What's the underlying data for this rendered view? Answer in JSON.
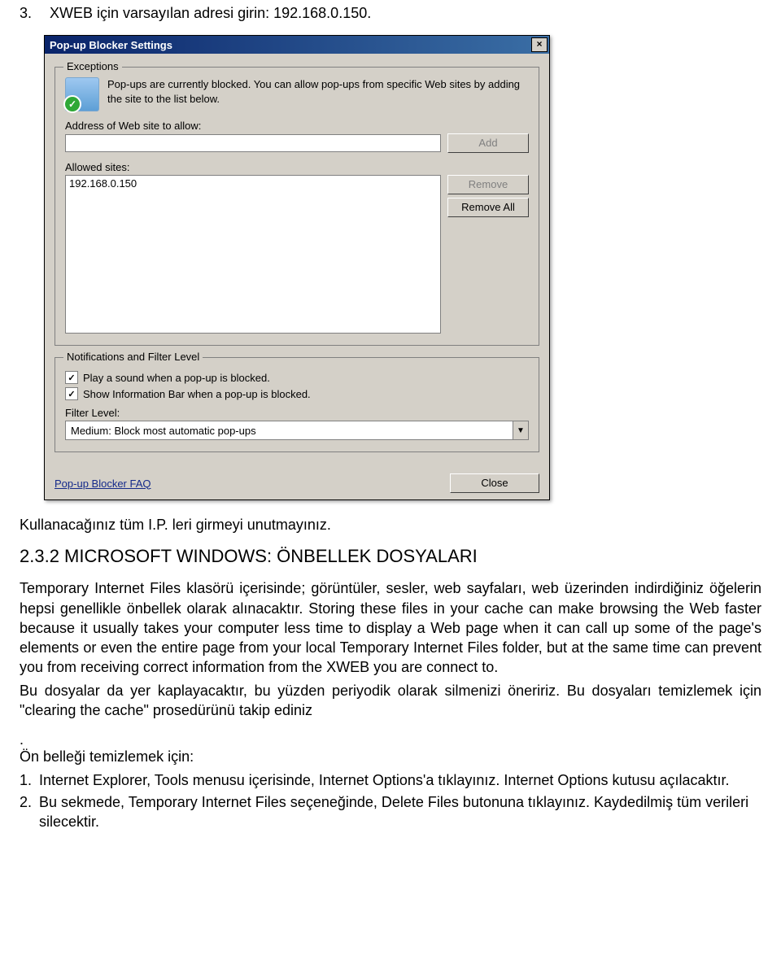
{
  "doc": {
    "step3_num": "3.",
    "step3_text": "XWEB için varsayılan adresi girin: 192.168.0.150.",
    "after_dialog": "Kullanacağınız tüm I.P. leri girmeyi unutmayınız.",
    "section_232": "2.3.2 MICROSOFT WINDOWS: ÖNBELLEK DOSYALARI",
    "body1": "Temporary Internet Files klasörü içerisinde; görüntüler, sesler, web sayfaları, web üzerinden indirdiğiniz öğelerin hepsi genellikle önbellek olarak alınacaktır. Storing these files in your cache can make browsing the Web faster because it usually takes your computer less time to display a Web page when it can call up some of the page's elements or even the entire page from your local Temporary Internet Files folder, but at the same time can prevent you from receiving correct information from the XWEB you are connect to.",
    "body2": "Bu dosyalar da yer kaplayacaktır, bu yüzden periyodik olarak silmenizi öneririz. Bu dosyaları temizlemek için \"clearing the cache\" prosedürünü takip ediniz",
    "body_dot": ".",
    "cache_clear_label": "Ön belleği temizlemek için:",
    "step1_num": "1.",
    "step1_text": "Internet Explorer, Tools menusu içerisinde, Internet Options'a tıklayınız. Internet Options kutusu açılacaktır.",
    "step2_num": "2.",
    "step2_text": "Bu sekmede, Temporary Internet Files seçeneğinde, Delete Files butonuna tıklayınız. Kaydedilmiş tüm verileri silecektir."
  },
  "dialog": {
    "title": "Pop-up Blocker Settings",
    "exceptions": {
      "legend": "Exceptions",
      "intro": "Pop-ups are currently blocked. You can allow pop-ups from specific Web sites by adding the site to the list below.",
      "address_label": "Address of Web site to allow:",
      "add_label": "Add",
      "allowed_label": "Allowed sites:",
      "site_item": "192.168.0.150",
      "remove_label": "Remove",
      "remove_all_label": "Remove All"
    },
    "filter": {
      "legend": "Notifications and Filter Level",
      "chk1_label": "Play a sound when a pop-up is blocked.",
      "chk2_label": "Show Information Bar when a pop-up is blocked.",
      "filter_label": "Filter Level:",
      "combo_value": "Medium: Block most automatic pop-ups"
    },
    "faq": "Pop-up Blocker FAQ",
    "close": "Close"
  }
}
